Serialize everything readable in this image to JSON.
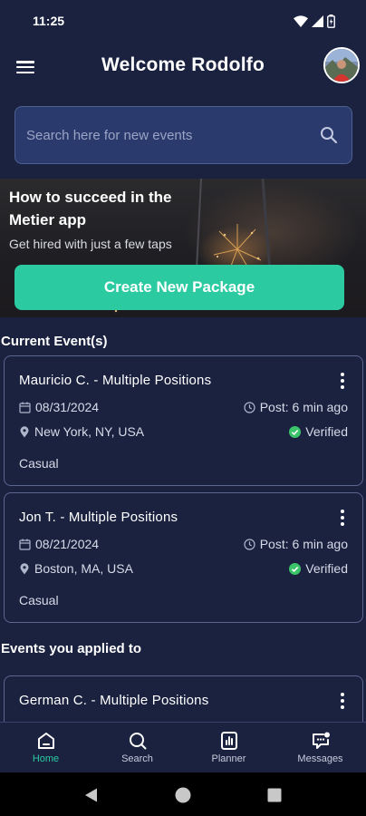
{
  "status_bar": {
    "time": "11:25"
  },
  "header": {
    "title": "Welcome Rodolfo"
  },
  "search": {
    "placeholder": "Search here for new events"
  },
  "banner": {
    "title": "How to succeed in the Metier app",
    "subtitle": "Get hired with just a few taps",
    "cta_label": "Create New Package"
  },
  "sections": {
    "current": "Current Event(s)",
    "applied": "Events you applied to"
  },
  "current_events": [
    {
      "title": "Mauricio C. - Multiple Positions",
      "date": "08/31/2024",
      "posted": "Post: 6 min ago",
      "location": "New York, NY, USA",
      "status": "Verified",
      "category": "Casual"
    },
    {
      "title": "Jon  T. - Multiple Positions",
      "date": "08/21/2024",
      "posted": "Post: 6 min ago",
      "location": "Boston, MA, USA",
      "status": "Verified",
      "category": "Casual"
    }
  ],
  "applied_events": [
    {
      "title": "German C. - Multiple Positions"
    }
  ],
  "bottom_nav": [
    {
      "label": "Home",
      "icon": "home-icon",
      "active": true
    },
    {
      "label": "Search",
      "icon": "search-icon",
      "active": false
    },
    {
      "label": "Planner",
      "icon": "planner-icon",
      "active": false
    },
    {
      "label": "Messages",
      "icon": "messages-icon",
      "active": false
    }
  ],
  "colors": {
    "background": "#1b2240",
    "accent": "#2bcaa0",
    "verified": "#3bc46a",
    "search_bg": "#2a3a6d"
  }
}
